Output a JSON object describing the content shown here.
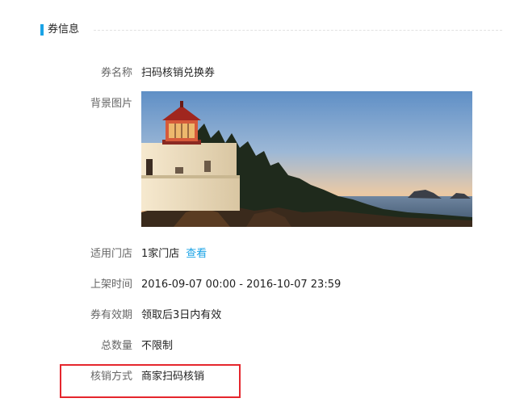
{
  "section": {
    "title": "券信息"
  },
  "fields": {
    "coupon_name": {
      "label": "券名称",
      "value": "扫码核销兑换券"
    },
    "background_image": {
      "label": "背景图片"
    },
    "applicable_stores": {
      "label": "适用门店",
      "value": "1家门店",
      "link": "查看"
    },
    "listing_time": {
      "label": "上架时间",
      "value": "2016-09-07 00:00 - 2016-10-07 23:59"
    },
    "validity": {
      "label": "券有效期",
      "value": "领取后3日内有效"
    },
    "total_quantity": {
      "label": "总数量",
      "value": "不限制"
    },
    "redemption_method": {
      "label": "核销方式",
      "value": "商家扫码核销"
    }
  },
  "colors": {
    "accent": "#1aa3e6",
    "highlight": "#e5262d"
  }
}
